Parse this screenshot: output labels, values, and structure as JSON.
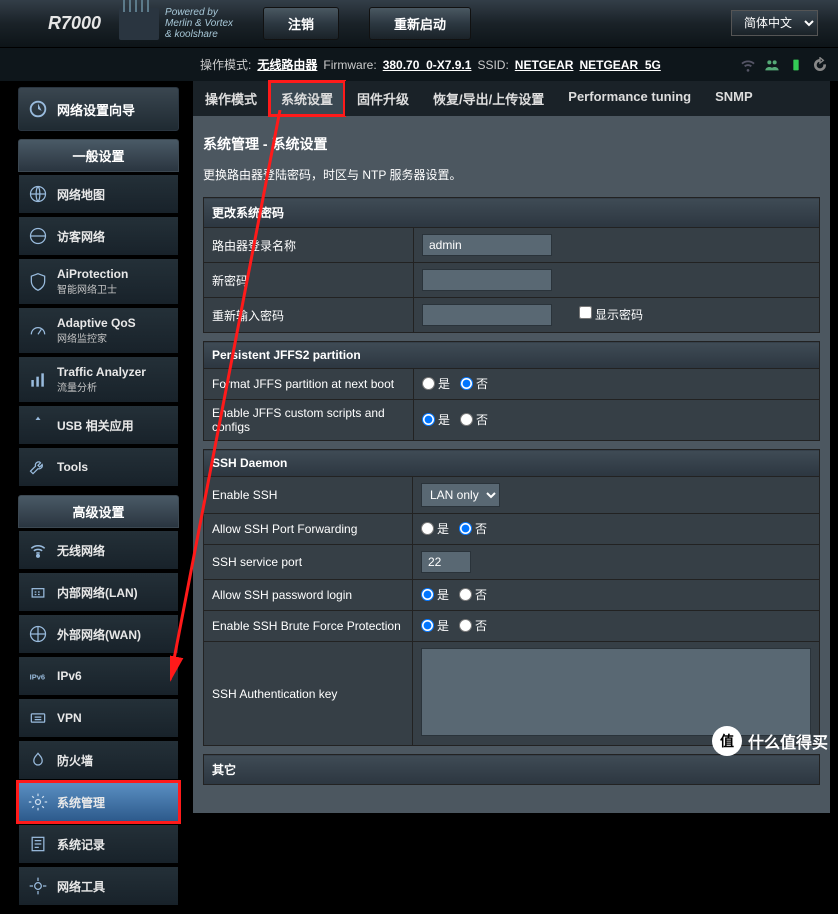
{
  "header": {
    "model": "R7000",
    "powered_line1": "Powered by",
    "powered_line2": "Merlin & Vortex",
    "powered_line3": "& koolshare",
    "btn_logout": "注销",
    "btn_reboot": "重新启动",
    "language": "简体中文"
  },
  "info": {
    "op_mode_label": "操作模式:",
    "op_mode_value": "无线路由器",
    "fw_label": "Firmware:",
    "fw_value": "380.70_0-X7.9.1",
    "ssid_label": "SSID:",
    "ssid_2g": "NETGEAR",
    "ssid_5g": "NETGEAR_5G"
  },
  "sidebar": {
    "wizard": "网络设置向导",
    "group_general": "一般设置",
    "group_advanced": "高级设置",
    "items_general": [
      {
        "label": "网络地图"
      },
      {
        "label": "访客网络"
      },
      {
        "label": "AiProtection",
        "sub": "智能网络卫士"
      },
      {
        "label": "Adaptive QoS",
        "sub": "网络监控家"
      },
      {
        "label": "Traffic Analyzer",
        "sub": "流量分析"
      },
      {
        "label": "USB 相关应用"
      },
      {
        "label": "Tools"
      }
    ],
    "items_advanced": [
      {
        "label": "无线网络"
      },
      {
        "label": "内部网络(LAN)"
      },
      {
        "label": "外部网络(WAN)"
      },
      {
        "label": "IPv6"
      },
      {
        "label": "VPN"
      },
      {
        "label": "防火墙"
      },
      {
        "label": "系统管理"
      },
      {
        "label": "系统记录"
      },
      {
        "label": "网络工具"
      }
    ]
  },
  "tabs": [
    "操作模式",
    "系统设置",
    "固件升级",
    "恢复/导出/上传设置",
    "Performance tuning",
    "SNMP"
  ],
  "page": {
    "title": "系统管理 - 系统设置",
    "desc": "更换路由器登陆密码，时区与 NTP 服务器设置。"
  },
  "sec_password": {
    "header": "更改系统密码",
    "row_login_name": "路由器登录名称",
    "login_name": "admin",
    "row_new_pw": "新密码",
    "row_retype": "重新输入密码",
    "show_pw": "显示密码"
  },
  "sec_jffs": {
    "header": "Persistent JFFS2 partition",
    "row_format": "Format JFFS partition at next boot",
    "row_scripts": "Enable JFFS custom scripts and configs"
  },
  "sec_ssh": {
    "header": "SSH Daemon",
    "row_enable": "Enable SSH",
    "enable_value": "LAN only",
    "row_forward": "Allow SSH Port Forwarding",
    "row_port": "SSH service port",
    "port_value": "22",
    "row_pwlogin": "Allow SSH password login",
    "row_brute": "Enable SSH Brute Force Protection",
    "row_authkey": "SSH Authentication key"
  },
  "sec_other": {
    "header": "其它"
  },
  "radio": {
    "yes": "是",
    "no": "否"
  },
  "watermark": {
    "icon": "值",
    "text": "什么值得买"
  }
}
